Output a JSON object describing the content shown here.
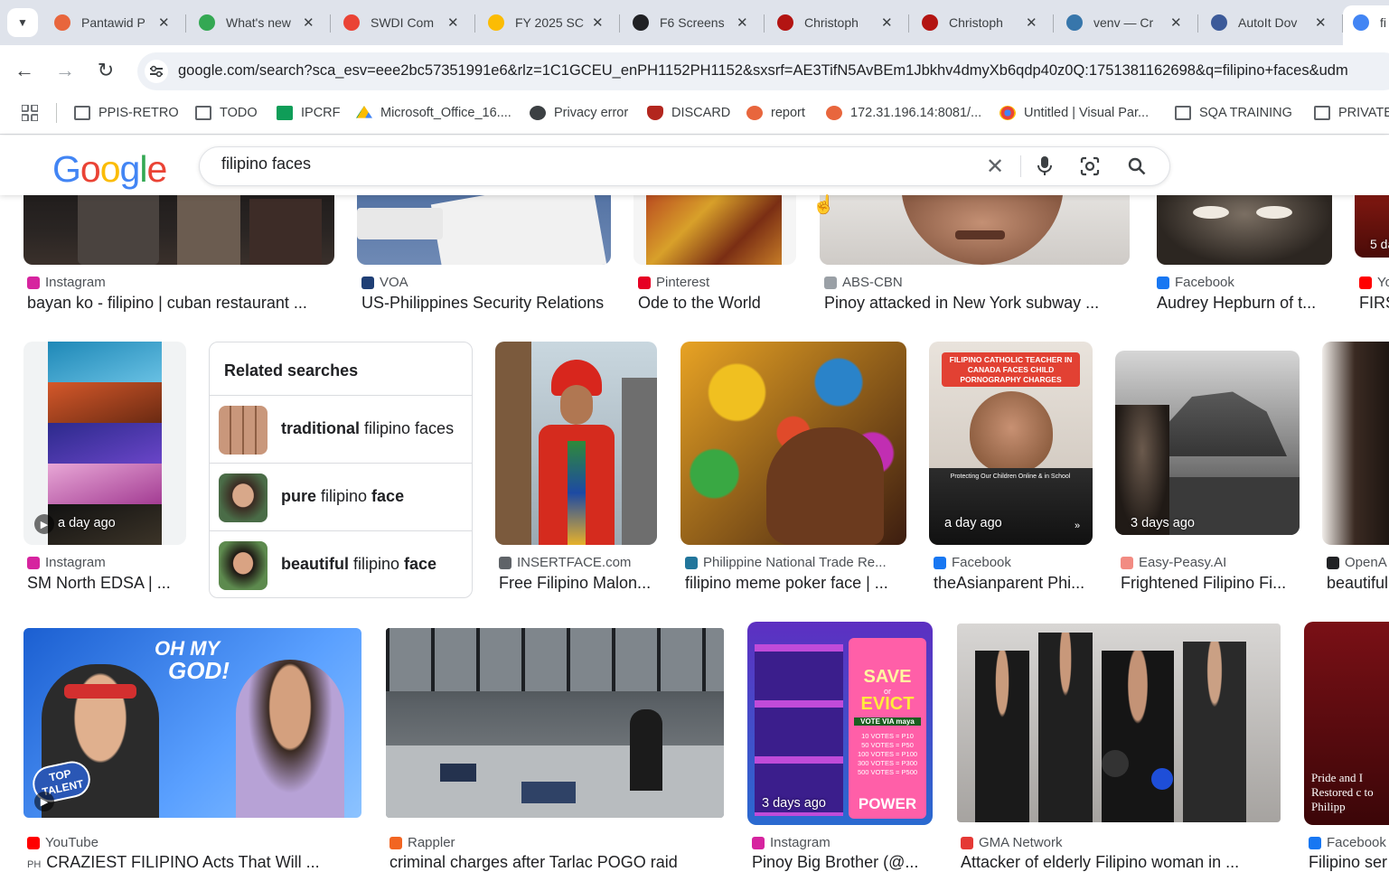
{
  "tabs": [
    {
      "title": "Pantawid P",
      "color": "#e8663d"
    },
    {
      "title": "What's new",
      "color": "#34a853"
    },
    {
      "title": "SWDI Com",
      "color": "#ea4335"
    },
    {
      "title": "FY 2025 SC",
      "color": "#fbbc04"
    },
    {
      "title": "F6 Screens",
      "color": "#202124"
    },
    {
      "title": "Christoph",
      "color": "#b31412"
    },
    {
      "title": "Christoph",
      "color": "#b31412"
    },
    {
      "title": "venv — Cr",
      "color": "#3776ab"
    },
    {
      "title": "AutoIt Dov",
      "color": "#3c5a99"
    },
    {
      "title": "fi",
      "color": "#4285f4"
    }
  ],
  "toolbar": {
    "url": "google.com/search?sca_esv=eee2bc57351991e6&rlz=1C1GCEU_enPH1152PH1152&sxsrf=AE3TifN5AvBEm1Jbkhv4dmyXb6qdp40z0Q:1751381162698&q=filipino+faces&udm"
  },
  "bookmarks": [
    {
      "label": "PPIS-RETRO",
      "icon": "folder"
    },
    {
      "label": "TODO",
      "icon": "folder"
    },
    {
      "label": "IPCRF",
      "icon": "sheets"
    },
    {
      "label": "Microsoft_Office_16....",
      "icon": "drive"
    },
    {
      "label": "Privacy error",
      "icon": "globe"
    },
    {
      "label": "DISCARD",
      "icon": "shield"
    },
    {
      "label": "report",
      "icon": "heart"
    },
    {
      "label": "172.31.196.14:8081/...",
      "icon": "heart"
    },
    {
      "label": "Untitled | Visual Par...",
      "icon": "visual"
    },
    {
      "label": "SQA TRAINING",
      "icon": "folder"
    },
    {
      "label": "PRIVATE",
      "icon": "folder"
    }
  ],
  "search": {
    "logo": "Google",
    "query": "filipino faces"
  },
  "row1": [
    {
      "source": "Instagram",
      "title": "bayan ko - filipino | cuban restaurant ...",
      "srccolor": "#d6249f"
    },
    {
      "source": "VOA",
      "title": "US-Philippines Security Relations",
      "srccolor": "#1f3f75"
    },
    {
      "source": "Pinterest",
      "title": "Ode to the World",
      "srccolor": "#e60023"
    },
    {
      "source": "ABS-CBN",
      "title": "Pinoy attacked in New York subway ...",
      "srccolor": "#9aa0a6"
    },
    {
      "source": "Facebook",
      "title": "Audrey Hepburn of t...",
      "srccolor": "#1877f2"
    },
    {
      "source": "Yo",
      "title": "FIRS",
      "srccolor": "#ff0000",
      "badge": "5 da"
    }
  ],
  "row2": [
    {
      "source": "Instagram",
      "title": "SM North EDSA | ...",
      "badge": "a day ago",
      "srccolor": "#d6249f"
    },
    {
      "source": "INSERTFACE.com",
      "title": "Free Filipino Malon...",
      "srccolor": "#5f6368"
    },
    {
      "source": "Philippine National Trade Re...",
      "title": "filipino meme poker face | ...",
      "srccolor": "#21759b"
    },
    {
      "source": "Facebook",
      "title": "theAsianparent Phi...",
      "badge": "a day ago",
      "srccolor": "#1877f2"
    },
    {
      "source": "Easy-Peasy.AI",
      "title": "Frightened Filipino Fi...",
      "badge": "3 days ago",
      "srccolor": "#f28b82"
    },
    {
      "source": "OpenA",
      "title": "beautiful",
      "srccolor": "#202124"
    }
  ],
  "related": {
    "heading": "Related searches",
    "items": [
      {
        "bold": "traditional",
        "rest": " filipino faces"
      },
      {
        "bold": "pure",
        "rest": " filipino ",
        "bold2": "face"
      },
      {
        "bold": "beautiful",
        "rest": " filipino ",
        "bold2": "face"
      }
    ]
  },
  "row3": [
    {
      "source": "YouTube",
      "title": "CRAZIEST FILIPINO Acts That Will ...",
      "prefix": "PH",
      "srccolor": "#ff0000"
    },
    {
      "source": "Rappler",
      "title": "criminal charges after Tarlac POGO raid",
      "srccolor": "#f26522"
    },
    {
      "source": "Instagram",
      "title": "Pinoy Big Brother (@...",
      "badge": "3 days ago",
      "srccolor": "#d6249f"
    },
    {
      "source": "GMA Network",
      "title": "Attacker of elderly Filipino woman in ...",
      "srccolor": "#e53935"
    },
    {
      "source": "Facebook",
      "title": "Filipino ser",
      "srccolor": "#1877f2"
    }
  ],
  "image_text": {
    "agt_line1": "OH MY",
    "agt_line2": "GOD!",
    "agt_logo": "TOP TALENT",
    "pbb_save": "SAVE",
    "pbb_or": "or",
    "pbb_evict": "EVICT",
    "pbb_vote": "VOTE VIA maya",
    "pbb_rates": [
      "10 VOTES = P10",
      "50 VOTES = P50",
      "100 VOTES = P100",
      "300 VOTES = P300",
      "500 VOTES = P500"
    ],
    "pbb_power": "POWER",
    "teacher_banner": "FILIPINO CATHOLIC TEACHER IN CANADA FACES CHILD PORNOGRAPHY CHARGES",
    "teacher_caption": "Protecting Our Children Online & in School",
    "pride": "Pride and I Restored c to Philipp"
  }
}
